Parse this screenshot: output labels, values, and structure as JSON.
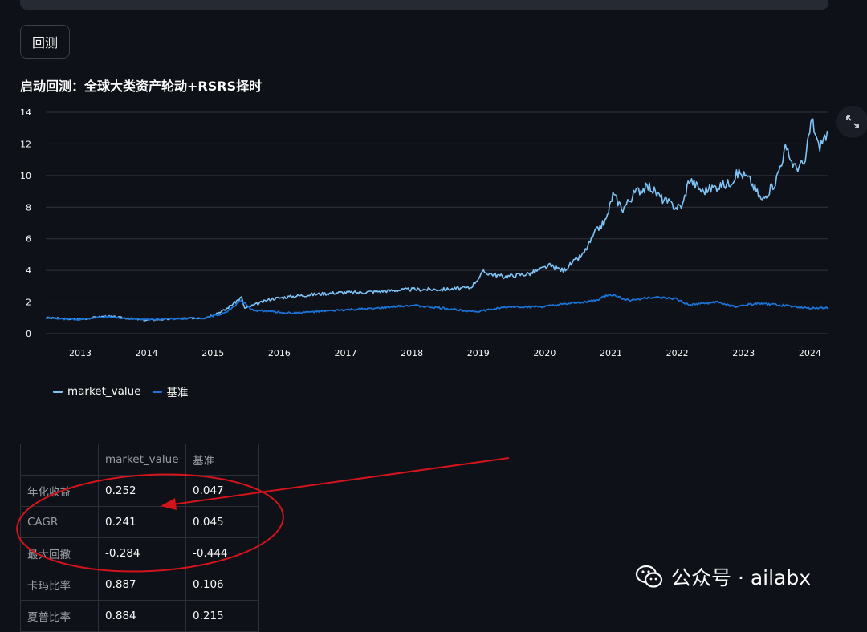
{
  "button": {
    "label": "回测"
  },
  "status_text": "启动回测：全球大类资产轮动+RSRS择时",
  "chart_data": {
    "type": "line",
    "x_ticks": [
      "2013",
      "2014",
      "2015",
      "2016",
      "2017",
      "2018",
      "2019",
      "2020",
      "2021",
      "2022",
      "2023",
      "2024"
    ],
    "y_ticks": [
      "0",
      "2",
      "4",
      "6",
      "8",
      "10",
      "12",
      "14"
    ],
    "ylim": [
      0,
      14
    ],
    "xlim": [
      2012.5,
      2024.3
    ],
    "series": [
      {
        "name": "market_value",
        "color": "#7fc4f7",
        "points": [
          [
            2012.5,
            1.0
          ],
          [
            2013.0,
            0.9
          ],
          [
            2013.4,
            1.1
          ],
          [
            2013.8,
            0.95
          ],
          [
            2014.0,
            0.85
          ],
          [
            2014.5,
            0.95
          ],
          [
            2014.9,
            1.0
          ],
          [
            2015.2,
            1.5
          ],
          [
            2015.45,
            2.3
          ],
          [
            2015.5,
            1.6
          ],
          [
            2015.7,
            1.9
          ],
          [
            2015.9,
            2.2
          ],
          [
            2016.1,
            2.3
          ],
          [
            2016.3,
            2.4
          ],
          [
            2016.6,
            2.5
          ],
          [
            2016.9,
            2.6
          ],
          [
            2017.2,
            2.6
          ],
          [
            2017.6,
            2.7
          ],
          [
            2018.0,
            2.8
          ],
          [
            2018.5,
            2.8
          ],
          [
            2018.9,
            2.9
          ],
          [
            2019.1,
            3.9
          ],
          [
            2019.4,
            3.6
          ],
          [
            2019.8,
            3.8
          ],
          [
            2020.1,
            4.3
          ],
          [
            2020.3,
            4.0
          ],
          [
            2020.6,
            5.0
          ],
          [
            2020.8,
            6.5
          ],
          [
            2020.95,
            7.2
          ],
          [
            2021.05,
            8.8
          ],
          [
            2021.2,
            7.9
          ],
          [
            2021.4,
            9.0
          ],
          [
            2021.6,
            9.3
          ],
          [
            2021.8,
            8.5
          ],
          [
            2022.0,
            8.0
          ],
          [
            2022.1,
            8.1
          ],
          [
            2022.2,
            9.8
          ],
          [
            2022.4,
            9.0
          ],
          [
            2022.6,
            9.3
          ],
          [
            2022.8,
            9.5
          ],
          [
            2022.95,
            10.2
          ],
          [
            2023.1,
            9.8
          ],
          [
            2023.3,
            8.4
          ],
          [
            2023.5,
            9.6
          ],
          [
            2023.65,
            11.7
          ],
          [
            2023.8,
            10.5
          ],
          [
            2023.95,
            10.8
          ],
          [
            2024.0,
            12.4
          ],
          [
            2024.05,
            13.6
          ],
          [
            2024.15,
            11.8
          ],
          [
            2024.3,
            12.8
          ]
        ]
      },
      {
        "name": "基准",
        "color": "#1a73d6",
        "points": [
          [
            2012.5,
            1.0
          ],
          [
            2013.0,
            0.9
          ],
          [
            2013.4,
            1.05
          ],
          [
            2013.8,
            0.95
          ],
          [
            2014.0,
            0.9
          ],
          [
            2014.5,
            0.95
          ],
          [
            2014.9,
            1.0
          ],
          [
            2015.2,
            1.3
          ],
          [
            2015.45,
            2.1
          ],
          [
            2015.6,
            1.5
          ],
          [
            2015.9,
            1.4
          ],
          [
            2016.2,
            1.3
          ],
          [
            2016.6,
            1.4
          ],
          [
            2017.0,
            1.5
          ],
          [
            2017.5,
            1.6
          ],
          [
            2018.0,
            1.8
          ],
          [
            2018.5,
            1.6
          ],
          [
            2019.0,
            1.4
          ],
          [
            2019.5,
            1.7
          ],
          [
            2020.0,
            1.7
          ],
          [
            2020.4,
            1.9
          ],
          [
            2020.8,
            2.1
          ],
          [
            2021.0,
            2.5
          ],
          [
            2021.3,
            2.1
          ],
          [
            2021.6,
            2.3
          ],
          [
            2022.0,
            2.2
          ],
          [
            2022.2,
            1.8
          ],
          [
            2022.6,
            2.0
          ],
          [
            2022.9,
            1.7
          ],
          [
            2023.2,
            1.9
          ],
          [
            2023.6,
            1.8
          ],
          [
            2024.0,
            1.6
          ],
          [
            2024.3,
            1.65
          ]
        ]
      }
    ]
  },
  "legend": [
    {
      "label": "market_value",
      "color": "#7fc4f7"
    },
    {
      "label": "基准",
      "color": "#1a73d6"
    }
  ],
  "table": {
    "headers": [
      "",
      "market_value",
      "基准"
    ],
    "rows": [
      {
        "label": "年化收益",
        "mv": "0.252",
        "bm": "0.047"
      },
      {
        "label": "CAGR",
        "mv": "0.241",
        "bm": "0.045"
      },
      {
        "label": "最大回撤",
        "mv": "-0.284",
        "bm": "-0.444"
      },
      {
        "label": "卡玛比率",
        "mv": "0.887",
        "bm": "0.106"
      },
      {
        "label": "夏普比率",
        "mv": "0.884",
        "bm": "0.215"
      }
    ]
  },
  "watermark": {
    "text": "公众号 · ailabx"
  }
}
